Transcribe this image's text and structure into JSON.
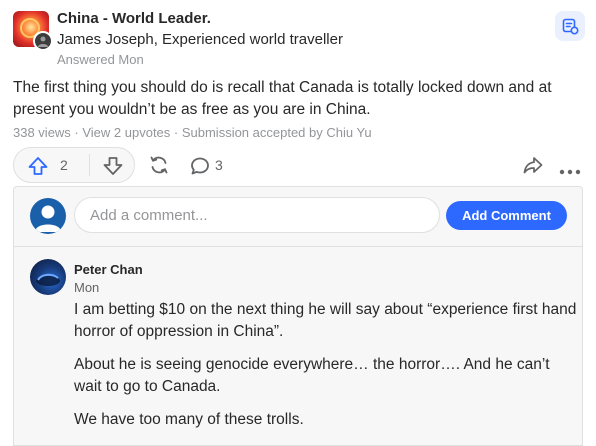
{
  "post": {
    "space_name": "China - World Leader.",
    "author_line": "James Joseph, Experienced world traveller",
    "answered": "Answered Mon",
    "body": "The first thing you should do is recall that Canada is totally locked down and at present you wouldn’t be as free as you are in China.",
    "meta": "338 views · View 2 upvotes · Submission accepted by Chiu Yu"
  },
  "actions": {
    "upvote_count": "2",
    "comment_count": "3",
    "icons": [
      "upvote-icon",
      "downvote-icon",
      "reshare-icon",
      "comment-icon",
      "share-icon",
      "more-icon",
      "notes-icon"
    ]
  },
  "comment_box": {
    "placeholder": "Add a comment...",
    "button_label": "Add Comment"
  },
  "comments": [
    {
      "author": "Peter Chan",
      "time": "Mon",
      "paragraphs": [
        "I am betting $10 on the next thing he will say about “experience first hand horror of oppression in China”.",
        "About he is seeing genocide everywhere… the horror…. And he can’t wait to go to Canada.",
        "We have too many of these trolls."
      ]
    }
  ],
  "colors": {
    "accent": "#2e69ff",
    "text": "#282829",
    "muted": "#939598",
    "panel_bg": "#f7f7f8",
    "border": "#dee0e1"
  }
}
